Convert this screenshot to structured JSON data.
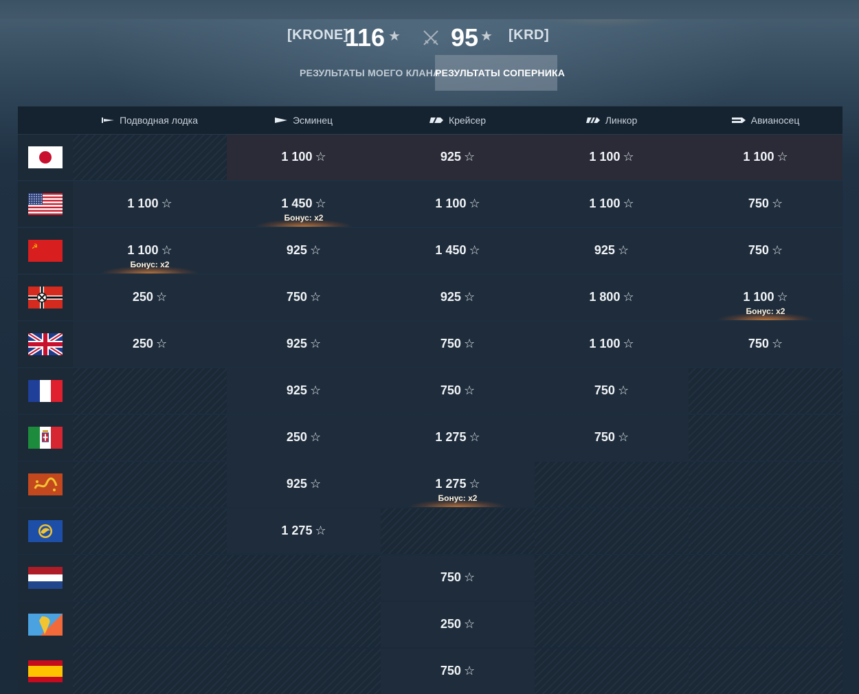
{
  "header": {
    "my_clan_tag": "[KRONE]",
    "my_score": "116",
    "rival_clan_tag": "[KRD]",
    "rival_score": "95",
    "star_glyph": "★",
    "tabs": [
      {
        "label": "РЕЗУЛЬТАТЫ МОЕГО КЛАНА",
        "active": false
      },
      {
        "label": "РЕЗУЛЬТАТЫ СОПЕРНИКА",
        "active": true
      }
    ]
  },
  "columns": [
    {
      "label": "Подводная лодка",
      "icon": "submarine-icon"
    },
    {
      "label": "Эсминец",
      "icon": "destroyer-icon"
    },
    {
      "label": "Крейсер",
      "icon": "cruiser-icon"
    },
    {
      "label": "Линкор",
      "icon": "battleship-icon"
    },
    {
      "label": "Авианосец",
      "icon": "carrier-icon"
    }
  ],
  "bonus_label": "Бонус: x2",
  "rows": [
    {
      "nation": "japan",
      "cells": [
        null,
        {
          "value": "1 100"
        },
        {
          "value": "925"
        },
        {
          "value": "1 100"
        },
        {
          "value": "1 100"
        }
      ]
    },
    {
      "nation": "usa",
      "cells": [
        {
          "value": "1 100"
        },
        {
          "value": "1 450",
          "bonus": true
        },
        {
          "value": "1 100"
        },
        {
          "value": "1 100"
        },
        {
          "value": "750"
        }
      ]
    },
    {
      "nation": "ussr",
      "cells": [
        {
          "value": "1 100",
          "bonus": true
        },
        {
          "value": "925"
        },
        {
          "value": "1 450"
        },
        {
          "value": "925"
        },
        {
          "value": "750"
        }
      ]
    },
    {
      "nation": "germany",
      "cells": [
        {
          "value": "250"
        },
        {
          "value": "750"
        },
        {
          "value": "925"
        },
        {
          "value": "1 800"
        },
        {
          "value": "1 100",
          "bonus": true
        }
      ]
    },
    {
      "nation": "uk",
      "cells": [
        {
          "value": "250"
        },
        {
          "value": "925"
        },
        {
          "value": "750"
        },
        {
          "value": "1 100"
        },
        {
          "value": "750"
        }
      ]
    },
    {
      "nation": "france",
      "cells": [
        null,
        {
          "value": "925"
        },
        {
          "value": "750"
        },
        {
          "value": "750"
        },
        null
      ]
    },
    {
      "nation": "italy",
      "cells": [
        null,
        {
          "value": "250"
        },
        {
          "value": "1 275"
        },
        {
          "value": "750"
        },
        null
      ]
    },
    {
      "nation": "pan-asia",
      "cells": [
        null,
        {
          "value": "925"
        },
        {
          "value": "1 275",
          "bonus": true
        },
        null,
        null
      ]
    },
    {
      "nation": "commonwealth",
      "cells": [
        null,
        {
          "value": "1 275"
        },
        null,
        null,
        null
      ]
    },
    {
      "nation": "netherlands",
      "cells": [
        null,
        null,
        {
          "value": "750"
        },
        null,
        null
      ]
    },
    {
      "nation": "pan-america",
      "cells": [
        null,
        null,
        {
          "value": "250"
        },
        null,
        null
      ]
    },
    {
      "nation": "spain",
      "cells": [
        null,
        null,
        {
          "value": "750"
        },
        null,
        null
      ]
    }
  ]
}
